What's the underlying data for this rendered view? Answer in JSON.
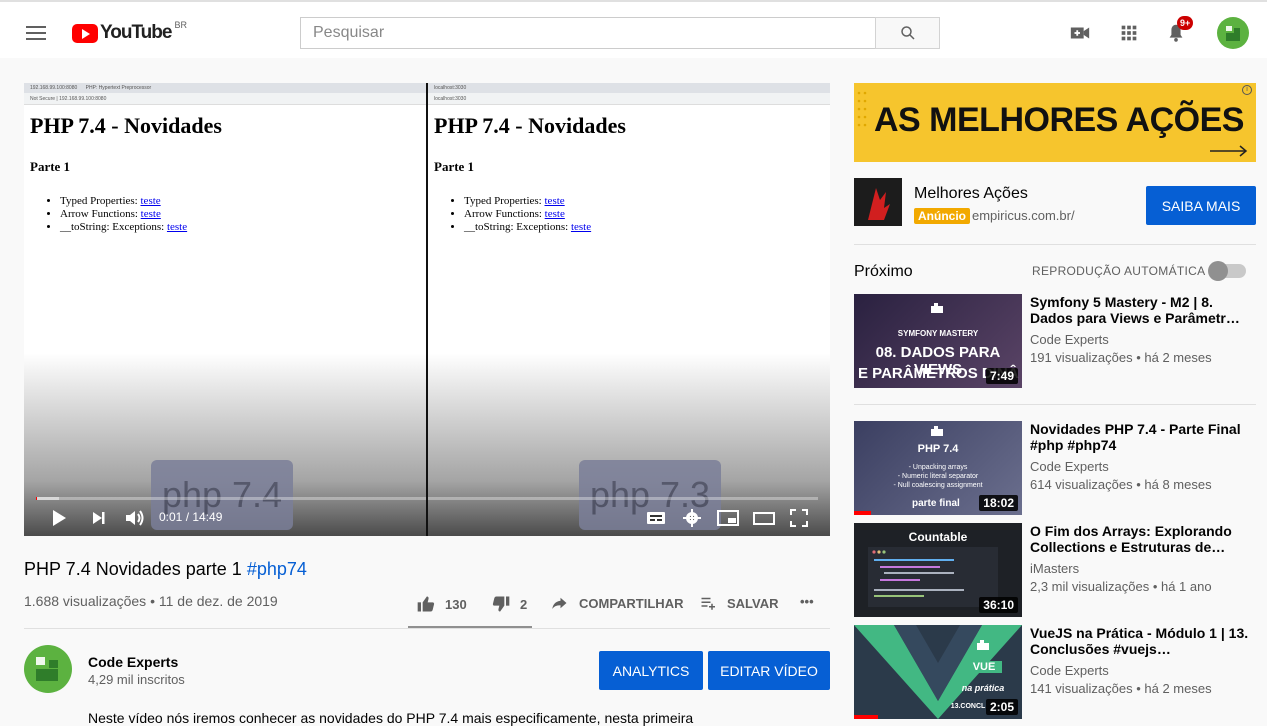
{
  "header": {
    "logo_text": "YouTube",
    "country_code": "BR",
    "search_placeholder": "Pesquisar",
    "notifications_badge": "9+"
  },
  "player": {
    "left_tab_1": "192.168.99.100:8080",
    "left_tab_2": "PHP: Hypertext Preprocessor",
    "left_url": "Not Secure | 192.168.99.100:8080",
    "right_tab": "localhost:3030",
    "right_url": "localhost:3030",
    "page_heading": "PHP 7.4 - Novidades",
    "page_subheading": "Parte 1",
    "page_items": [
      {
        "text": "Typed Properties: ",
        "link": "teste"
      },
      {
        "text": "Arrow Functions: ",
        "link": "teste"
      },
      {
        "text": "__toString: Exceptions: ",
        "link": "teste"
      }
    ],
    "left_overlay": "php 7.4",
    "right_overlay": "php 7.3",
    "time_current": "0:01",
    "time_total": "14:49",
    "time_display": "0:01 / 14:49",
    "progress_fraction": 0.001,
    "buffer_fraction": 0.03
  },
  "video": {
    "title": "PHP 7.4 Novidades parte 1",
    "hashtag": "#php74",
    "views_date": "1.688 visualizações • 11 de dez. de 2019",
    "likes": "130",
    "dislikes": "2",
    "share_label": "COMPARTILHAR",
    "save_label": "SALVAR",
    "more_label": "•••"
  },
  "channel": {
    "name": "Code Experts",
    "subscribers": "4,29 mil inscritos",
    "analytics_label": "ANALYTICS",
    "edit_label": "EDITAR VÍDEO",
    "description": "Neste vídeo nós iremos conhecer as novidades do PHP 7.4 mais especificamente, nesta primeira"
  },
  "ad": {
    "banner_text": "AS MELHORES AÇÕES",
    "banner_info": "i",
    "name": "Melhores Ações",
    "tag": "Anúncio",
    "domain": "empiricus.com.br/",
    "cta": "SAIBA MAIS"
  },
  "sidebar": {
    "next_label": "Próximo",
    "autoplay_label": "REPRODUÇÃO AUTOMÁTICA",
    "autoplay_on": false,
    "items": [
      {
        "title": "Symfony 5 Mastery - M2 | 8. Dados para Views e Parâmetr…",
        "channel": "Code Experts",
        "meta": "191 visualizações • há 2 meses",
        "duration": "7:49",
        "thumb_line1": "SYMFONY MASTERY",
        "thumb_line2": "08. DADOS PARA VIEWS",
        "thumb_line3": "E PARÂMETROS DINÂ",
        "thumb_color": "#3b2f4e",
        "watched_fraction": 0
      },
      {
        "title": "Novidades PHP 7.4 - Parte Final #php #php74",
        "channel": "Code Experts",
        "meta": "614 visualizações • há 8 meses",
        "duration": "18:02",
        "thumb_line1": "PHP 7.4",
        "thumb_line2": "- Unpacking arrays",
        "thumb_line3": "- Numeric literal separator",
        "thumb_line4": "- Null coalescing assignment",
        "thumb_line5": "parte final",
        "thumb_color": "#4a4f73",
        "watched_fraction": 0.1
      },
      {
        "title": "O Fim dos Arrays: Explorando Collections e Estruturas de…",
        "channel": "iMasters",
        "meta": "2,3 mil visualizações • há 1 ano",
        "duration": "36:10",
        "thumb_line1": "Countable",
        "thumb_color": "#1e2126",
        "watched_fraction": 0
      },
      {
        "title": "VueJS na Prática - Módulo 1 | 13. Conclusões #vuejs…",
        "channel": "Code Experts",
        "meta": "141 visualizações • há 2 meses",
        "duration": "2:05",
        "thumb_line1": "VUE",
        "thumb_line2": "na prática",
        "thumb_line3": "13.CONCL",
        "thumb_color": "#2b3a4a",
        "watched_fraction": 0.14
      }
    ]
  },
  "colors": {
    "brand_red": "#ff0000",
    "link_blue": "#065fd4",
    "ad_yellow": "#f6c52d",
    "channel_green": "#5cb240"
  },
  "icons": [
    "menu-icon",
    "search-icon",
    "video-camera-icon",
    "apps-icon",
    "bell-icon",
    "play-icon",
    "next-icon",
    "volume-icon",
    "subtitles-icon",
    "settings-icon",
    "miniplayer-icon",
    "theater-icon",
    "fullscreen-icon",
    "thumbs-up-icon",
    "thumbs-down-icon",
    "share-icon",
    "playlist-add-icon",
    "more-icon"
  ]
}
